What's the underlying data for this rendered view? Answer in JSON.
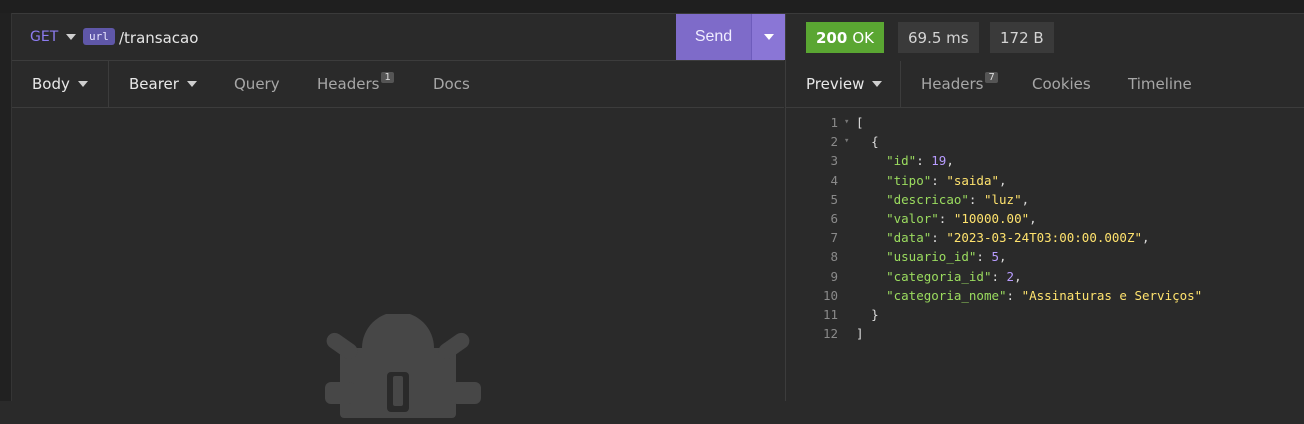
{
  "request": {
    "method": "GET",
    "url_tag": "url",
    "path": "/transacao",
    "send_label": "Send"
  },
  "request_tabs": {
    "body": "Body",
    "auth": "Bearer",
    "query": "Query",
    "headers": "Headers",
    "headers_count": "1",
    "docs": "Docs"
  },
  "response": {
    "status_code": "200",
    "status_text": "OK",
    "time": "69.5 ms",
    "size": "172 B"
  },
  "response_tabs": {
    "preview": "Preview",
    "headers": "Headers",
    "headers_count": "7",
    "cookies": "Cookies",
    "timeline": "Timeline"
  },
  "json_lines": [
    {
      "n": "1",
      "fold": true,
      "indent": "",
      "parts": [
        [
          "p",
          "["
        ]
      ]
    },
    {
      "n": "2",
      "fold": true,
      "indent": "  ",
      "parts": [
        [
          "p",
          "{"
        ]
      ]
    },
    {
      "n": "3",
      "indent": "    ",
      "parts": [
        [
          "k",
          "\"id\""
        ],
        [
          "p",
          ": "
        ],
        [
          "n",
          "19"
        ],
        [
          "p",
          ","
        ]
      ]
    },
    {
      "n": "4",
      "indent": "    ",
      "parts": [
        [
          "k",
          "\"tipo\""
        ],
        [
          "p",
          ": "
        ],
        [
          "s",
          "\"saida\""
        ],
        [
          "p",
          ","
        ]
      ]
    },
    {
      "n": "5",
      "indent": "    ",
      "parts": [
        [
          "k",
          "\"descricao\""
        ],
        [
          "p",
          ": "
        ],
        [
          "s",
          "\"luz\""
        ],
        [
          "p",
          ","
        ]
      ]
    },
    {
      "n": "6",
      "indent": "    ",
      "parts": [
        [
          "k",
          "\"valor\""
        ],
        [
          "p",
          ": "
        ],
        [
          "s",
          "\"10000.00\""
        ],
        [
          "p",
          ","
        ]
      ]
    },
    {
      "n": "7",
      "indent": "    ",
      "parts": [
        [
          "k",
          "\"data\""
        ],
        [
          "p",
          ": "
        ],
        [
          "s",
          "\"2023-03-24T03:00:00.000Z\""
        ],
        [
          "p",
          ","
        ]
      ]
    },
    {
      "n": "8",
      "indent": "    ",
      "parts": [
        [
          "k",
          "\"usuario_id\""
        ],
        [
          "p",
          ": "
        ],
        [
          "n",
          "5"
        ],
        [
          "p",
          ","
        ]
      ]
    },
    {
      "n": "9",
      "indent": "    ",
      "parts": [
        [
          "k",
          "\"categoria_id\""
        ],
        [
          "p",
          ": "
        ],
        [
          "n",
          "2"
        ],
        [
          "p",
          ","
        ]
      ]
    },
    {
      "n": "10",
      "indent": "    ",
      "parts": [
        [
          "k",
          "\"categoria_nome\""
        ],
        [
          "p",
          ": "
        ],
        [
          "s",
          "\"Assinaturas e Serviços\""
        ]
      ]
    },
    {
      "n": "11",
      "indent": "  ",
      "parts": [
        [
          "p",
          "}"
        ]
      ]
    },
    {
      "n": "12",
      "indent": "",
      "parts": [
        [
          "p",
          "]"
        ]
      ]
    }
  ],
  "colors": {
    "accent": "#7e6bc9",
    "method": "#8d7cf0",
    "status_ok": "#5aa632",
    "json_key": "#9bdc5f",
    "json_string": "#ffe36e",
    "json_number": "#b89cff"
  },
  "icons": {
    "empty_state": "bug-robot-icon"
  }
}
